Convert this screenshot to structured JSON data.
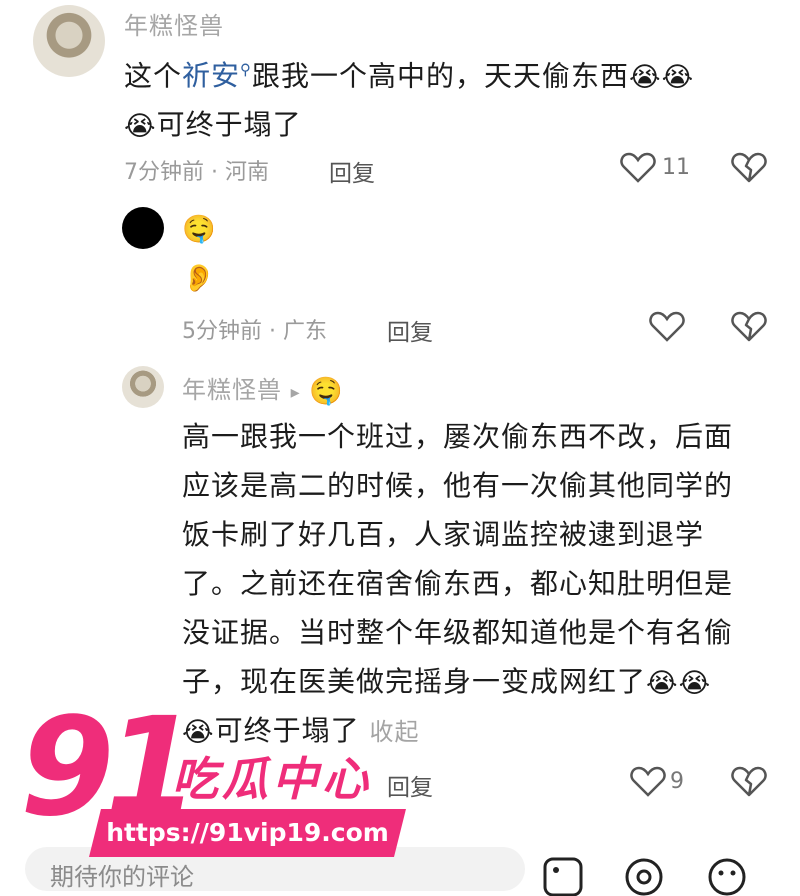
{
  "comments": [
    {
      "username": "年糕怪兽",
      "text_prefix": "这个",
      "link_text": "祈安",
      "text_line1_rest": "跟我一个高中的，天天偷东西",
      "emoji_laugh": "😭",
      "text_line2": "可终于塌了",
      "time_location": "7分钟前 · 河南",
      "reply_label": "回复",
      "likes": "11"
    },
    {
      "username": "",
      "emoji_drool": "🤤",
      "emoji_ear": "👂",
      "time_location": "5分钟前 · 广东",
      "reply_label": "回复"
    },
    {
      "username": "年糕怪兽",
      "arrow": "▸",
      "emoji_drool": "🤤",
      "lines": [
        "高一跟我一个班过，屡次偷东西不改，后面",
        "应该是高二的时候，他有一次偷其他同学的",
        "饭卡刷了好几百，人家调监控被逮到退学",
        "了。之前还在宿舍偷东西，都心知肚明但是",
        "没证据。当时整个年级都知道他是个有名偷",
        "子，现在医美做完摇身一变成网红了"
      ],
      "last_line": "可终于塌了",
      "collapse_label": "收起",
      "reply_label": "回复",
      "likes": "9"
    }
  ],
  "watermark": {
    "number": "91",
    "title": "吃瓜中心",
    "url": "https://91vip19.com"
  },
  "input": {
    "placeholder": "期待你的评论"
  },
  "colors": {
    "watermark": "#ef2d7a",
    "link": "#2f5f9f"
  }
}
